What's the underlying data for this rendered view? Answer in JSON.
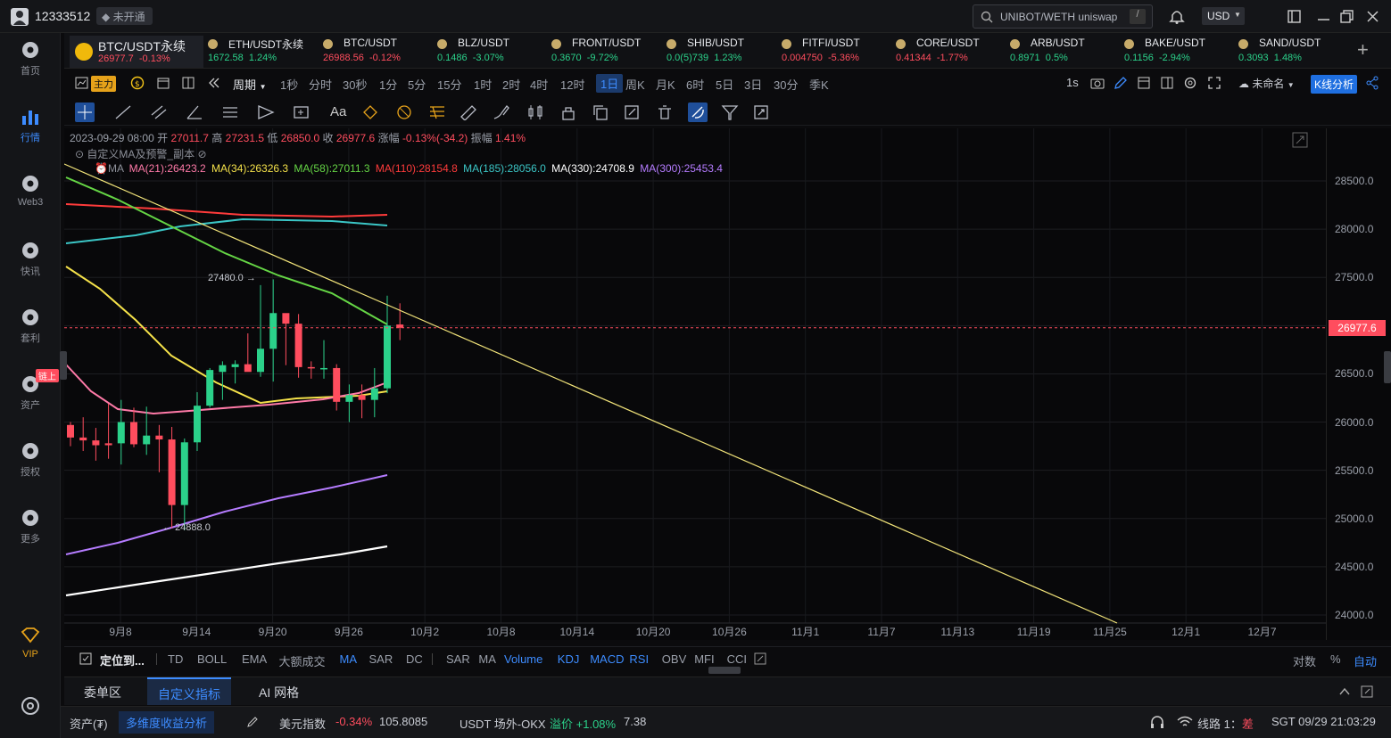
{
  "user": {
    "id": "12333512",
    "badge": "未开通"
  },
  "search": {
    "value": "UNIBOT/WETH uniswap",
    "shortcut": "/"
  },
  "currency": "USD",
  "sidebar": [
    {
      "label": "首页",
      "icon": "home-icon"
    },
    {
      "label": "行情",
      "icon": "chart-bar-icon",
      "active": true
    },
    {
      "label": "Web3",
      "icon": "web3-icon"
    },
    {
      "label": "快讯",
      "icon": "news-icon"
    },
    {
      "label": "套利",
      "icon": "arbitrage-icon"
    },
    {
      "label": "资产",
      "icon": "wallet-icon",
      "tag": "链上"
    },
    {
      "label": "授权",
      "icon": "authorize-icon"
    },
    {
      "label": "更多",
      "icon": "more-icon"
    },
    {
      "label": "VIP",
      "icon": "vip-icon"
    }
  ],
  "tabs": [
    {
      "name": "BTC/USDT永续",
      "price": "26977.7",
      "change": "-0.13%",
      "dir": "dn",
      "active": true
    },
    {
      "name": "ETH/USDT永续",
      "price": "1672.58",
      "change": "1.24%",
      "dir": "up"
    },
    {
      "name": "BTC/USDT",
      "price": "26988.56",
      "change": "-0.12%",
      "dir": "dn"
    },
    {
      "name": "BLZ/USDT",
      "price": "0.1486",
      "change": "-3.07%",
      "dir": "up"
    },
    {
      "name": "FRONT/USDT",
      "price": "0.3670",
      "change": "-9.72%",
      "dir": "up"
    },
    {
      "name": "SHIB/USDT",
      "price": "0.0(5)739",
      "change": "1.23%",
      "dir": "up"
    },
    {
      "name": "FITFI/USDT",
      "price": "0.004750",
      "change": "-5.36%",
      "dir": "dn"
    },
    {
      "name": "CORE/USDT",
      "price": "0.41344",
      "change": "-1.77%",
      "dir": "dn"
    },
    {
      "name": "ARB/USDT",
      "price": "0.8971",
      "change": "0.5%",
      "dir": "up"
    },
    {
      "name": "BAKE/USDT",
      "price": "0.1156",
      "change": "-2.94%",
      "dir": "up"
    },
    {
      "name": "SAND/USDT",
      "price": "0.3093",
      "change": "1.48%",
      "dir": "up"
    }
  ],
  "toolbar": {
    "main_label": "主力",
    "period_label": "周期",
    "timeframes": [
      "1秒",
      "分时",
      "30秒",
      "1分",
      "5分",
      "15分",
      "1时",
      "2时",
      "4时",
      "12时",
      "1日",
      "周K",
      "月K",
      "6时",
      "5日",
      "3日",
      "30分",
      "季K"
    ],
    "selected": "1日",
    "right_1s": "1s",
    "layout_name": "未命名",
    "kline_analysis": "K线分析"
  },
  "ohlc": {
    "date": "2023-09-29 08:00",
    "open_l": "开",
    "open": "27011.7",
    "high_l": "高",
    "high": "27231.5",
    "low_l": "低",
    "low": "26850.0",
    "close_l": "收",
    "close": "26977.6",
    "chg_l": "涨幅",
    "chg": "-0.13%(-34.2)",
    "amp_l": "振幅",
    "amp": "1.41%"
  },
  "indicator_name": "自定义MA及预警_副本",
  "ma_label": "MA",
  "ma": [
    {
      "label": "MA(21):26423.2",
      "color": "#ff7aa8"
    },
    {
      "label": "MA(34):26326.3",
      "color": "#f5e24a"
    },
    {
      "label": "MA(58):27011.3",
      "color": "#65d545"
    },
    {
      "label": "MA(110):28154.8",
      "color": "#ff3b3b"
    },
    {
      "label": "MA(185):28056.0",
      "color": "#3bc6c6"
    },
    {
      "label": "MA(330):24708.9",
      "color": "#ffffff"
    },
    {
      "label": "MA(300):25453.4",
      "color": "#b57cff"
    }
  ],
  "annotations": {
    "high": "27480.0",
    "low": "24888.0"
  },
  "current_price": "26977.6",
  "chart_data": {
    "type": "candlestick",
    "ylim": [
      23950,
      28700
    ],
    "yticks": [
      "28500.0",
      "28000.0",
      "27500.0",
      "27000.0",
      "26500.0",
      "26000.0",
      "25500.0",
      "25000.0",
      "24500.0",
      "24000.0"
    ],
    "xticks": [
      "9月8",
      "9月14",
      "9月20",
      "9月26",
      "10月2",
      "10月8",
      "10月14",
      "10月20",
      "10月26",
      "11月1",
      "11月7",
      "11月13",
      "11月19",
      "11月25",
      "12月1",
      "12月7"
    ],
    "candles": [
      [
        25970,
        26000,
        25750,
        25840
      ],
      [
        25840,
        26050,
        25700,
        25810
      ],
      [
        25810,
        25940,
        25600,
        25760
      ],
      [
        25780,
        26190,
        25620,
        25760
      ],
      [
        25780,
        26230,
        25560,
        26000
      ],
      [
        26000,
        26150,
        25740,
        25770
      ],
      [
        25770,
        26160,
        25660,
        25860
      ],
      [
        25860,
        25970,
        25480,
        25820
      ],
      [
        25820,
        25950,
        24900,
        25140
      ],
      [
        25140,
        25830,
        24880,
        25790
      ],
      [
        25790,
        26310,
        25700,
        26170
      ],
      [
        26170,
        26560,
        26150,
        26540
      ],
      [
        26520,
        26630,
        26230,
        26590
      ],
      [
        26570,
        26640,
        26400,
        26600
      ],
      [
        26600,
        26920,
        26560,
        26520
      ],
      [
        26520,
        27420,
        26470,
        26760
      ],
      [
        26760,
        27480,
        26420,
        27130
      ],
      [
        27130,
        27080,
        26590,
        27020
      ],
      [
        27020,
        27120,
        26460,
        26570
      ],
      [
        26570,
        26630,
        26450,
        26560
      ],
      [
        26560,
        26850,
        26450,
        26560
      ],
      [
        26560,
        26600,
        26120,
        26210
      ],
      [
        26210,
        26390,
        26000,
        26280
      ],
      [
        26280,
        26390,
        26040,
        26230
      ],
      [
        26230,
        26560,
        26050,
        26350
      ],
      [
        26350,
        27310,
        26300,
        27000
      ],
      [
        27011.7,
        27231.5,
        26850.0,
        26977.6
      ]
    ]
  },
  "indicators": {
    "locate": "定位到...",
    "main": [
      "TD",
      "BOLL",
      "EMA",
      "大额成交",
      "MA",
      "SAR",
      "DC"
    ],
    "main_on": [
      "MA"
    ],
    "sub": [
      "SAR",
      "MA",
      "Volume",
      "KDJ",
      "MACD",
      "RSI",
      "OBV",
      "MFI",
      "CCI"
    ],
    "sub_on": [
      "Volume",
      "KDJ",
      "MACD",
      "RSI"
    ],
    "scale": [
      "对数",
      "%",
      "自动"
    ],
    "scale_on": "自动"
  },
  "bottom_tabs": [
    "委单区",
    "自定义指标",
    "AI 网格"
  ],
  "bottom_active": "自定义指标",
  "status": {
    "asset_label": "资产(₮)",
    "analysis": "多维度收益分析",
    "dxy_label": "美元指数",
    "dxy_chg": "-0.34%",
    "dxy_val": "105.8085",
    "otc_label": "USDT 场外-OKX",
    "premium_label": "溢价",
    "premium": "+1.08%",
    "premium_val": "7.38",
    "route": "线路 1：",
    "route_quality": "差",
    "time": "SGT  09/29 21:03:29"
  }
}
